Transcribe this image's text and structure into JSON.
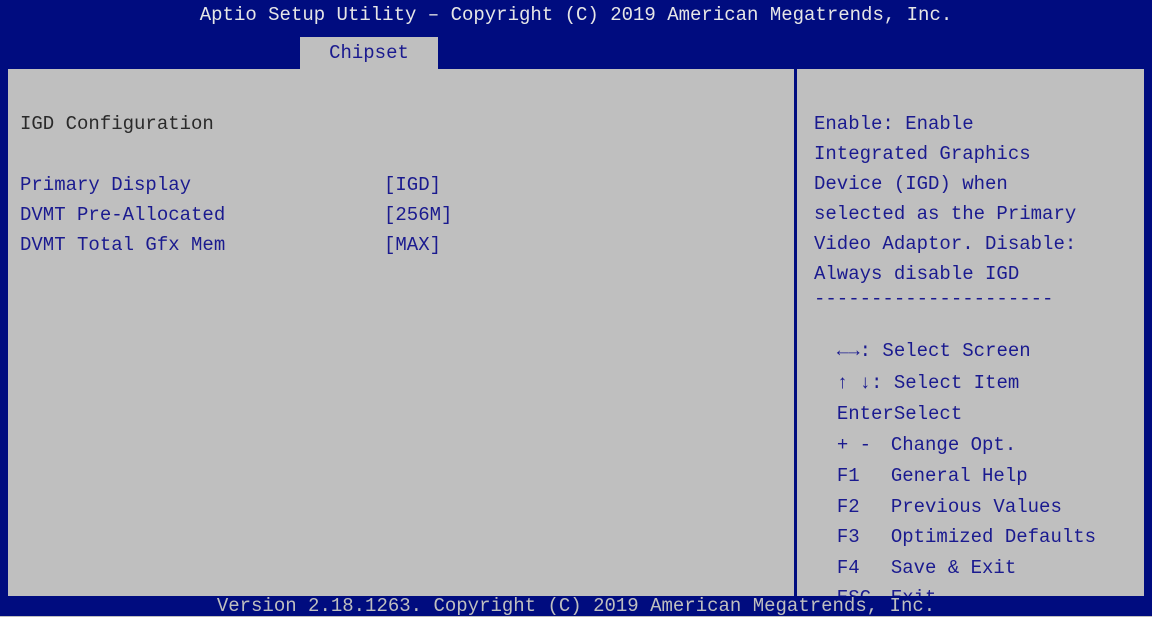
{
  "header": {
    "title": "Aptio Setup Utility – Copyright (C) 2019 American Megatrends, Inc.",
    "tab": "Chipset"
  },
  "main": {
    "section_title": "IGD Configuration",
    "items": [
      {
        "label": "Primary Display",
        "value": "[IGD]"
      },
      {
        "label": "DVMT Pre-Allocated",
        "value": "[256M]"
      },
      {
        "label": "DVMT Total Gfx Mem",
        "value": "[MAX]"
      }
    ]
  },
  "help": {
    "lines": [
      "Enable: Enable",
      "Integrated Graphics",
      "Device (IGD) when",
      "selected as the Primary",
      "Video Adaptor. Disable:",
      "Always disable IGD",
      "---------------------"
    ]
  },
  "keys": [
    {
      "key": "←→",
      "desc": ": Select Screen"
    },
    {
      "key": "↑ ↓",
      "desc": ": Select Item"
    },
    {
      "key": "Enter",
      "desc": "Select"
    },
    {
      "key": "+ -",
      "desc": "Change Opt."
    },
    {
      "key": "F1",
      "desc": "General Help"
    },
    {
      "key": "F2",
      "desc": "Previous Values"
    },
    {
      "key": "F3",
      "desc": "Optimized Defaults"
    },
    {
      "key": "F4",
      "desc": "Save & Exit"
    },
    {
      "key": "ESC",
      "desc": "Exit"
    }
  ],
  "footer": {
    "version": "Version 2.18.1263. Copyright (C) 2019 American Megatrends, Inc."
  },
  "colors": {
    "bios_blue": "#000c7f",
    "panel_gray": "#bfbfbf",
    "item_text": "#1a1a8f"
  }
}
